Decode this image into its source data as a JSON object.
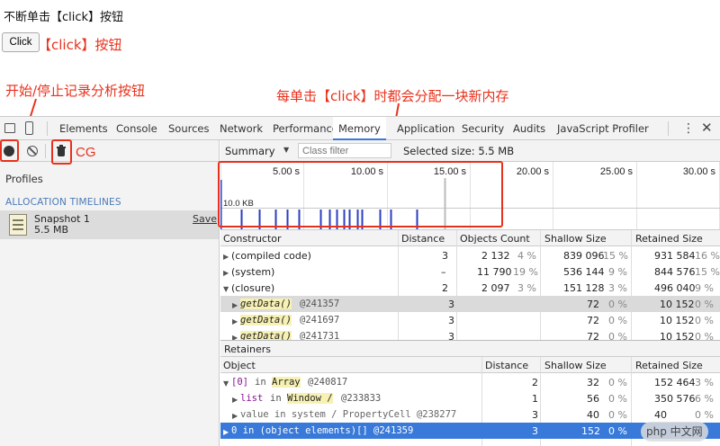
{
  "page": {
    "heading": "不断单击【click】按钮",
    "click_button": "Click",
    "click_note": "【click】按钮",
    "record_note": "开始/停止记录分析按钮",
    "alloc_note": "每单击【click】时都会分配一块新内存",
    "cg_note": "CG"
  },
  "devtools": {
    "tabs": [
      "Elements",
      "Console",
      "Sources",
      "Network",
      "Performance",
      "Memory",
      "Application",
      "Security",
      "Audits",
      "JavaScript Profiler"
    ],
    "active_tab": "Memory",
    "toolbar": {
      "view": "Summary",
      "filter_placeholder": "Class filter",
      "selected_size": "Selected size: 5.5 MB"
    },
    "sidebar": {
      "profiles_label": "Profiles",
      "section": "ALLOCATION TIMELINES",
      "snapshot_name": "Snapshot 1",
      "snapshot_size": "5.5 MB",
      "save_link": "Save"
    },
    "timeline": {
      "ticks": [
        "5.00 s",
        "10.00 s",
        "15.00 s",
        "20.00 s",
        "25.00 s",
        "30.00 s"
      ],
      "scale_label": "10.0 KB"
    },
    "constructor_table": {
      "headers": [
        "Constructor",
        "Distance",
        "Objects Count",
        "Shallow Size",
        "Retained Size"
      ],
      "rows": [
        {
          "name": "(compiled code)",
          "dist": "3",
          "count": "2 132",
          "count_pct": "4 %",
          "shallow": "839 096",
          "shallow_pct": "15 %",
          "retained": "931 584",
          "retained_pct": "16 %"
        },
        {
          "name": "(system)",
          "dist": "–",
          "count": "11 790",
          "count_pct": "19 %",
          "shallow": "536 144",
          "shallow_pct": "9 %",
          "retained": "844 576",
          "retained_pct": "15 %"
        },
        {
          "name": "(closure)",
          "dist": "2",
          "count": "2 097",
          "count_pct": "3 %",
          "shallow": "151 128",
          "shallow_pct": "3 %",
          "retained": "496 040",
          "retained_pct": "9 %"
        },
        {
          "name": "getData()",
          "id": "@241357",
          "dist": "3",
          "shallow": "72",
          "shallow_pct": "0 %",
          "retained": "10 152",
          "retained_pct": "0 %"
        },
        {
          "name": "getData()",
          "id": "@241697",
          "dist": "3",
          "shallow": "72",
          "shallow_pct": "0 %",
          "retained": "10 152",
          "retained_pct": "0 %"
        },
        {
          "name": "getData()",
          "id": "@241731",
          "dist": "3",
          "shallow": "72",
          "shallow_pct": "0 %",
          "retained": "10 152",
          "retained_pct": "0 %"
        }
      ]
    },
    "retainers": {
      "title": "Retainers",
      "headers": [
        "Object",
        "Distance",
        "Shallow Size",
        "Retained Size"
      ],
      "rows": [
        {
          "pre": "[0]",
          "mid": "in",
          "type": "Array",
          "id": "@240817",
          "dist": "2",
          "shallow": "32",
          "shallow_pct": "0 %",
          "retained": "152 464",
          "retained_pct": "3 %"
        },
        {
          "pre": "list",
          "mid": "in",
          "type": "Window /",
          "id": "@233833",
          "dist": "1",
          "shallow": "56",
          "shallow_pct": "0 %",
          "retained": "350 576",
          "retained_pct": "6 %"
        },
        {
          "text": "value in system / PropertyCell @238277",
          "dist": "3",
          "shallow": "40",
          "shallow_pct": "0 %",
          "retained": "40",
          "retained_pct": "0 %"
        },
        {
          "text": "0 in (object elements)[] @241359",
          "dist": "3",
          "shallow": "152",
          "shallow_pct": "0 %",
          "retained": "",
          "retained_pct": ""
        }
      ]
    },
    "watermark": "php 中文网"
  }
}
